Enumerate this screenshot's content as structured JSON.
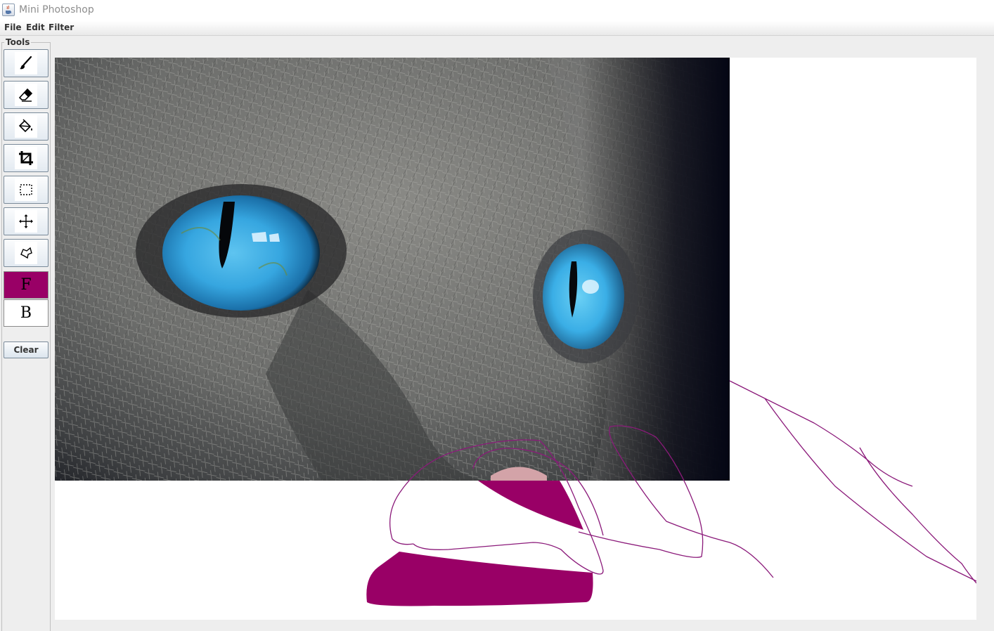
{
  "window": {
    "title": "Mini Photoshop",
    "icon": "java-cup-icon"
  },
  "menu": {
    "file": "File",
    "edit": "Edit",
    "filter": "Filter"
  },
  "tools": {
    "legend": "Tools",
    "buttons": [
      "brush-icon",
      "eraser-icon",
      "paint-bucket-icon",
      "crop-icon",
      "rectangle-select-icon",
      "move-icon",
      "lasso-icon"
    ],
    "foreground_label": "F",
    "background_label": "B",
    "clear_label": "Clear"
  },
  "colors": {
    "foreground": "#990066",
    "background": "#ffffff",
    "stroke": "#8b1a7a"
  },
  "canvas": {
    "image": "cat-face-photo",
    "content": "gray cat close-up with blue eyes, magenta freehand strokes and filled shapes"
  }
}
